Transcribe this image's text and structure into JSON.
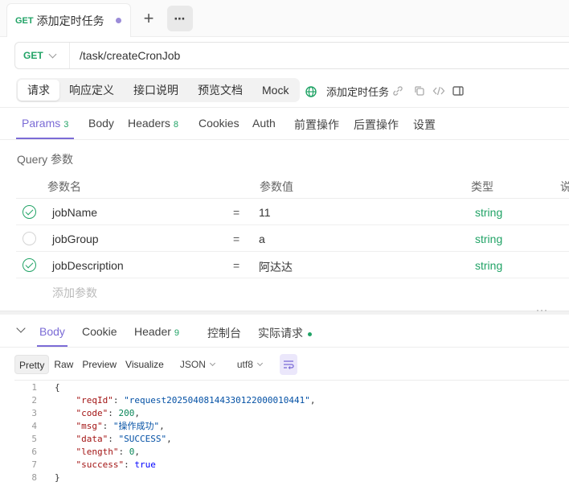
{
  "tab": {
    "method": "GET",
    "title": "添加定时任务",
    "more": "⋯",
    "add": "+"
  },
  "urlbar": {
    "method": "GET",
    "url": "/task/createCronJob"
  },
  "request_tabs": [
    "请求",
    "响应定义",
    "接口说明",
    "预览文档",
    "Mock"
  ],
  "api_name": "添加定时任务",
  "param_tabs": [
    {
      "label": "Params",
      "count": "3"
    },
    {
      "label": "Body",
      "count": ""
    },
    {
      "label": "Headers",
      "count": "8"
    },
    {
      "label": "Cookies",
      "count": ""
    },
    {
      "label": "Auth",
      "count": ""
    },
    {
      "label": "前置操作",
      "count": ""
    },
    {
      "label": "后置操作",
      "count": ""
    },
    {
      "label": "设置",
      "count": ""
    }
  ],
  "query_label": "Query 参数",
  "table": {
    "headers": [
      "参数名",
      "参数值",
      "类型",
      "说"
    ],
    "rows": [
      {
        "enabled": true,
        "name": "jobName",
        "eq": "=",
        "value": "11",
        "type": "string"
      },
      {
        "enabled": false,
        "name": "jobGroup",
        "eq": "=",
        "value": "a",
        "type": "string"
      },
      {
        "enabled": true,
        "name": "jobDescription",
        "eq": "=",
        "value": "阿达达",
        "type": "string"
      }
    ],
    "add_placeholder": "添加参数"
  },
  "splitter_dots": "···",
  "response_tabs": [
    {
      "label": "Body",
      "count": ""
    },
    {
      "label": "Cookie",
      "count": ""
    },
    {
      "label": "Header",
      "count": "9"
    },
    {
      "label": "控制台",
      "count": ""
    },
    {
      "label": "实际请求",
      "count": ""
    }
  ],
  "view_modes": [
    "Pretty",
    "Raw",
    "Preview",
    "Visualize"
  ],
  "format": "JSON",
  "encoding": "utf8",
  "code_lines": [
    {
      "n": "1",
      "html": "{"
    },
    {
      "n": "2",
      "key": "reqId",
      "val": "\"request20250408144330122000010441\"",
      "vt": "s",
      "comma": true
    },
    {
      "n": "3",
      "key": "code",
      "val": "200",
      "vt": "n",
      "comma": true
    },
    {
      "n": "4",
      "key": "msg",
      "val": "\"操作成功\"",
      "vt": "s",
      "comma": true
    },
    {
      "n": "5",
      "key": "data",
      "val": "\"SUCCESS\"",
      "vt": "s",
      "comma": true
    },
    {
      "n": "6",
      "key": "length",
      "val": "0",
      "vt": "n",
      "comma": true
    },
    {
      "n": "7",
      "key": "success",
      "val": "true",
      "vt": "b",
      "comma": false
    },
    {
      "n": "8",
      "html": "}"
    }
  ],
  "colors": {
    "accent": "#7b6bd6",
    "green": "#21a366"
  }
}
